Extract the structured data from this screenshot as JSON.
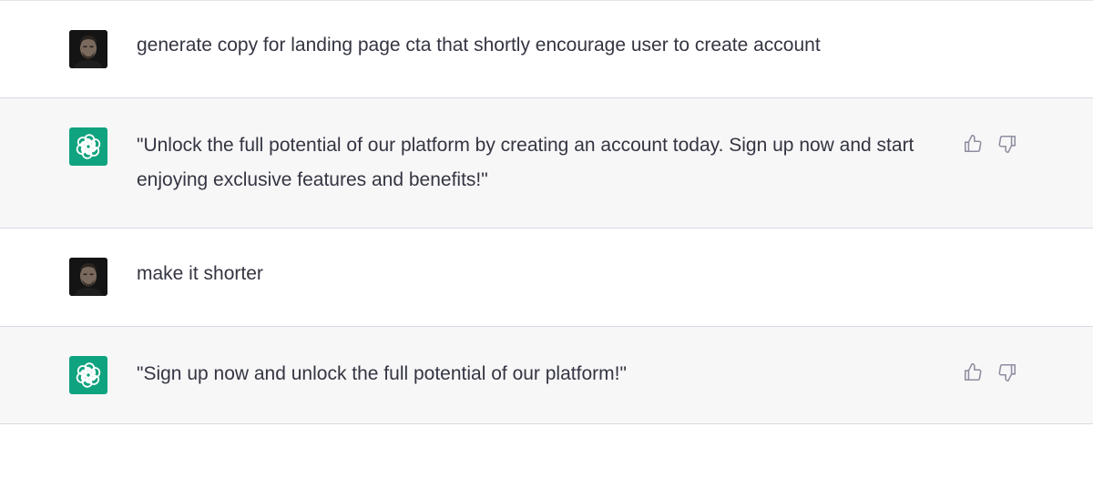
{
  "colors": {
    "assistant_bg": "#f7f7f8",
    "user_bg": "#ffffff",
    "brand_green": "#10a37f",
    "text": "#343541",
    "icon": "#8e8ea0"
  },
  "messages": [
    {
      "role": "user",
      "avatar": "user-photo",
      "text": "generate copy for landing page cta that shortly encourage user to create account"
    },
    {
      "role": "assistant",
      "avatar": "openai-logo-icon",
      "text": "\"Unlock the full potential of our platform by creating an account today. Sign up now and start enjoying exclusive features and benefits!\"",
      "actions": [
        "thumbs-up-icon",
        "thumbs-down-icon"
      ]
    },
    {
      "role": "user",
      "avatar": "user-photo",
      "text": "make it shorter"
    },
    {
      "role": "assistant",
      "avatar": "openai-logo-icon",
      "text": "\"Sign up now and unlock the full potential of our platform!\"",
      "actions": [
        "thumbs-up-icon",
        "thumbs-down-icon"
      ]
    }
  ]
}
